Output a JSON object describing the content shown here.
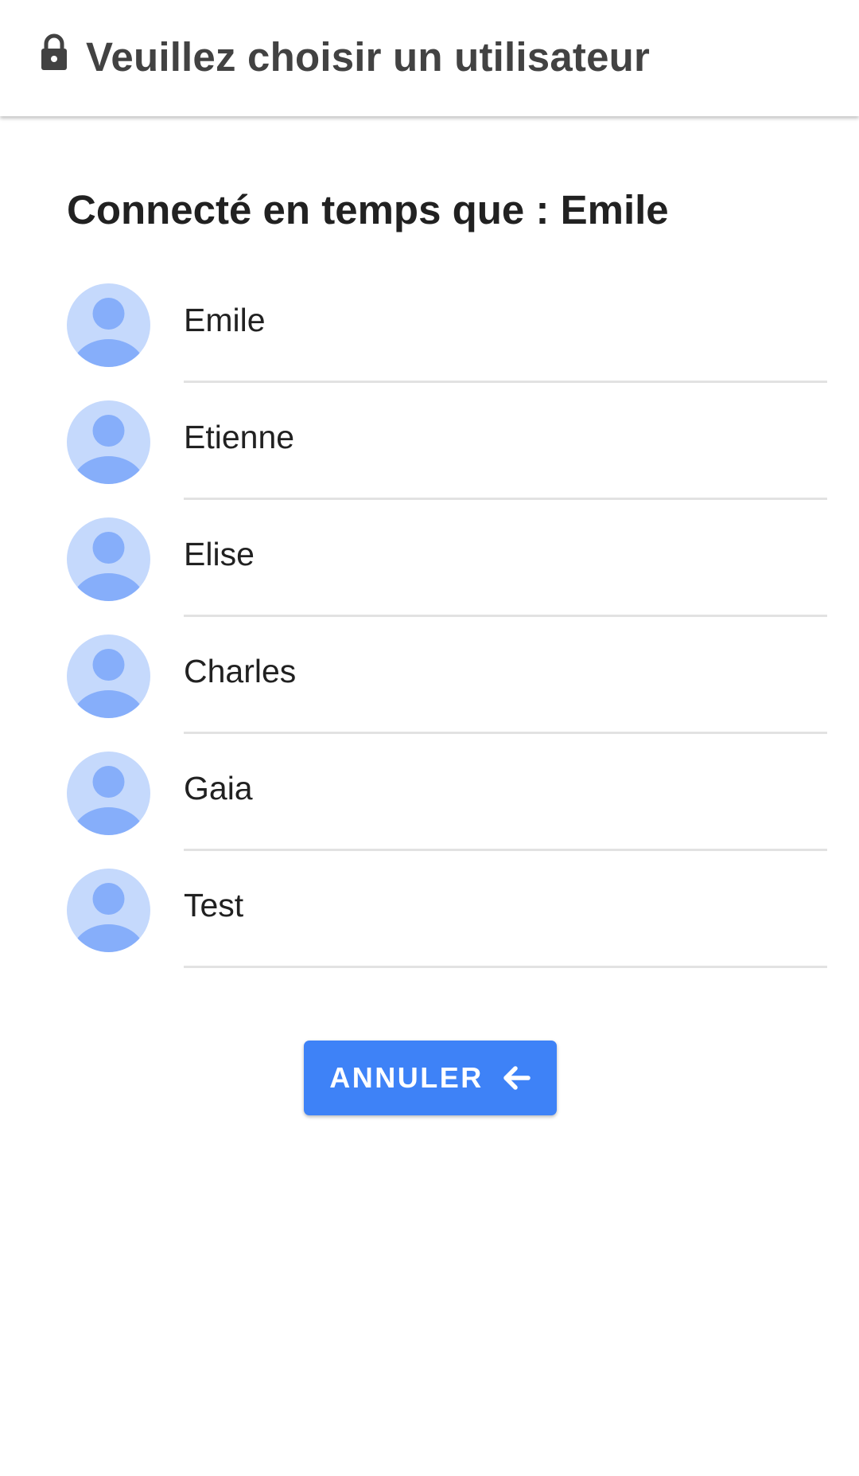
{
  "app_bar": {
    "icon": "lock-icon",
    "title": "Veuillez choisir un utilisateur"
  },
  "connected": {
    "label": "Connecté en temps que : Emile"
  },
  "users": [
    {
      "name": "Emile",
      "avatar": "default-avatar-icon"
    },
    {
      "name": "Etienne",
      "avatar": "default-avatar-icon"
    },
    {
      "name": "Elise",
      "avatar": "default-avatar-icon"
    },
    {
      "name": "Charles",
      "avatar": "default-avatar-icon"
    },
    {
      "name": "Gaia",
      "avatar": "default-avatar-icon"
    },
    {
      "name": "Test",
      "avatar": "default-avatar-icon"
    }
  ],
  "cancel_button": {
    "label": "ANNULER",
    "icon": "arrow-left-icon"
  },
  "colors": {
    "accent": "#3e82f7",
    "avatar_bg": "#c5d9fc",
    "avatar_fg": "#86aefa",
    "title_text": "#424242",
    "divider": "#e2e2e2"
  }
}
